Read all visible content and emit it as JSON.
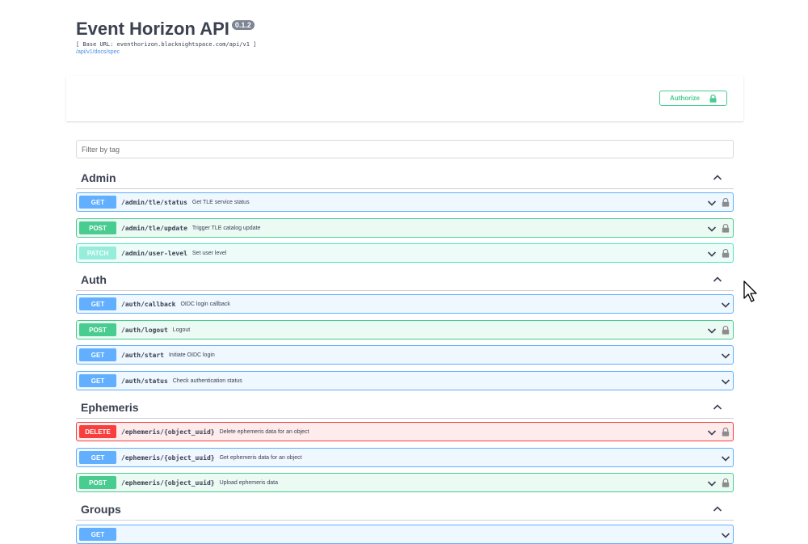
{
  "info": {
    "title": "Event Horizon API",
    "version": "0.1.2",
    "base_url": "[ Base URL: eventhorizon.blacknightspace.com/api/v1 ]",
    "spec_link": "/api/v1/docs/spec"
  },
  "authorize": {
    "label": "Authorize",
    "icon": "lock-icon"
  },
  "filter": {
    "placeholder": "Filter by tag",
    "value": ""
  },
  "colors": {
    "get": "#61affe",
    "post": "#49cc90",
    "patch": "#50e3c2",
    "delete": "#f93e3e",
    "text": "#3b4151"
  },
  "sections": [
    {
      "name": "Admin",
      "operations": [
        {
          "method": "GET",
          "path": "/admin/tle/status",
          "summary": "Get TLE service status",
          "locked": true
        },
        {
          "method": "POST",
          "path": "/admin/tle/update",
          "summary": "Trigger TLE catalog update",
          "locked": true
        },
        {
          "method": "PATCH",
          "path": "/admin/user-level",
          "summary": "Set user level",
          "locked": true
        }
      ]
    },
    {
      "name": "Auth",
      "operations": [
        {
          "method": "GET",
          "path": "/auth/callback",
          "summary": "OIDC login callback",
          "locked": false
        },
        {
          "method": "POST",
          "path": "/auth/logout",
          "summary": "Logout",
          "locked": true
        },
        {
          "method": "GET",
          "path": "/auth/start",
          "summary": "Initiate OIDC login",
          "locked": false
        },
        {
          "method": "GET",
          "path": "/auth/status",
          "summary": "Check authentication status",
          "locked": false
        }
      ]
    },
    {
      "name": "Ephemeris",
      "operations": [
        {
          "method": "DELETE",
          "path": "/ephemeris/{object_uuid}",
          "summary": "Delete ephemeris data for an object",
          "locked": true
        },
        {
          "method": "GET",
          "path": "/ephemeris/{object_uuid}",
          "summary": "Get ephemeris data for an object",
          "locked": false
        },
        {
          "method": "POST",
          "path": "/ephemeris/{object_uuid}",
          "summary": "Upload ephemeris data",
          "locked": true
        }
      ]
    },
    {
      "name": "Groups",
      "operations": [
        {
          "method": "GET",
          "path": "",
          "summary": "",
          "locked": false
        }
      ]
    }
  ]
}
